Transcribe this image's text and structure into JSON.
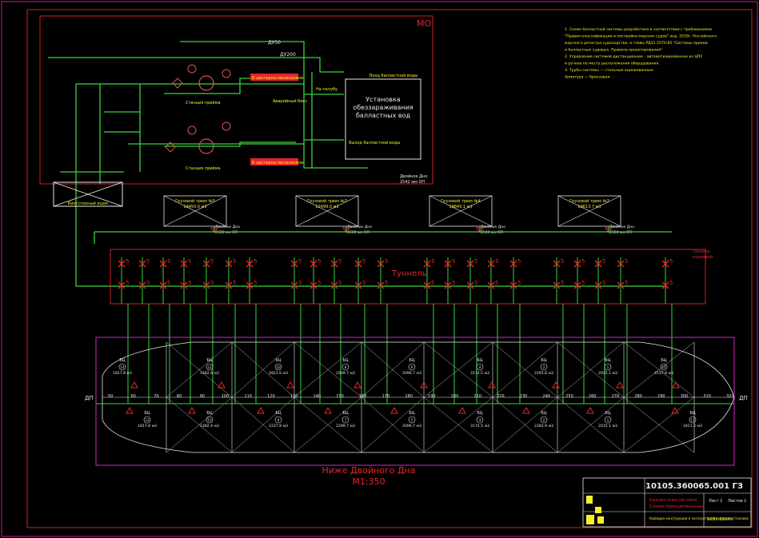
{
  "colors": {
    "background": "#000000",
    "frame": "#cc1b8f",
    "border": "#d42020",
    "pipe": "#39d43a",
    "valve": "#e8242c",
    "text_white": "#e8e8e8",
    "text_yellow": "#f4f02a",
    "hull": "#d028c8",
    "pump": "#e05050"
  },
  "engine_room": {
    "label": "МО",
    "pipe_du50": "ДУ50",
    "pipe_du200": "ДУ200",
    "treatment_unit": "Установка обеззараживания балластных вод",
    "water_inlet": "Вход балластной воды",
    "water_outlet": "Выход балластной воды",
    "to_tanks_a": "В цистерны механизмов",
    "to_tanks_b": "В цистерны механизмов",
    "to_deck": "На палубу",
    "air_box": "Аварийный бокс",
    "from_sea_a": "Станция приёма",
    "from_sea_b": "Станция приёма",
    "db_note": "Двойное Дно\n2542 мм ОП",
    "sea_chest": "Кингстонный ящик"
  },
  "notes": [
    "1. Схема балластной системы разработана в соответствии с требованиями",
    "\"Правил классификации и постройки морских судов\" изд. 2019г. Российского",
    "морского регистра судоходства, и главы РД31.5570-85 \"Системы приема",
    "и балластных судовых. Правила проектирования\"",
    "2. Управление системой дистанционное - автоматизированное из ЦПУ",
    "и ручное по месту расположения оборудования.",
    "3. Трубы системы — стальные оцинкованные.",
    "Арматура — бронзовая."
  ],
  "cargo_holds": [
    {
      "name": "Грузовой трюм №5",
      "volume": "19450.0 м3",
      "db": "Двойное Дно\n2500 мм ОП"
    },
    {
      "name": "Грузовой трюм №3",
      "volume": "22499.0 м3",
      "db": "Двойное Дно\n2500 мм ОП"
    },
    {
      "name": "Грузовой трюм №4",
      "volume": "19849.1 м3",
      "db": "Двойное Дно\n2500 мм ОП"
    },
    {
      "name": "Грузовой трюм №2",
      "volume": "19613.7 м3",
      "db": "Двойное Дно\n2500 мм ОП"
    }
  ],
  "tunnel_label": "Туннель",
  "tunnel_side": "Туннель\nкормовой",
  "frame_ticks": [
    "50",
    "60",
    "70",
    "80",
    "90",
    "100",
    "110",
    "120",
    "130",
    "140",
    "150",
    "160",
    "170",
    "180",
    "190",
    "200",
    "210",
    "220",
    "230",
    "240",
    "250",
    "260",
    "270",
    "280",
    "290",
    "300",
    "310",
    "320"
  ],
  "dp": "ДП",
  "upper_tanks": [
    {
      "id": "БЦ",
      "num": "14",
      "vol": "1817.8 м3"
    },
    {
      "id": "БЦ",
      "num": "12",
      "vol": "1482.4 м3"
    },
    {
      "id": "БЦ",
      "num": "10",
      "vol": "2821.6 м3"
    },
    {
      "id": "БЦ",
      "num": "8",
      "vol": "2509.7 м3"
    },
    {
      "id": "БЦ",
      "num": "6",
      "vol": "2096.7 м3"
    },
    {
      "id": "БЦ",
      "num": "4",
      "vol": "3174.5 м3"
    },
    {
      "id": "БЦ",
      "num": "2",
      "vol": "2265.8 м3"
    },
    {
      "id": "БЦ",
      "num": "1",
      "vol": "2015.1 м3"
    },
    {
      "id": "БЦ",
      "num": "15",
      "vol": "4537.8 м3"
    }
  ],
  "lower_tanks": [
    {
      "id": "БЦ",
      "num": "13",
      "vol": "1817.8 м3"
    },
    {
      "id": "БЦ",
      "num": "11",
      "vol": "1482.4 м3"
    },
    {
      "id": "БЦ",
      "num": "9",
      "vol": "2227.8 м3"
    },
    {
      "id": "БЦ",
      "num": "7",
      "vol": "2299.7 м3"
    },
    {
      "id": "БЦ",
      "num": "5",
      "vol": "2096.7 м3"
    },
    {
      "id": "БЦ",
      "num": "3",
      "vol": "3174.5 м3"
    },
    {
      "id": "БЦ",
      "num": "2",
      "vol": "2282.9 м3"
    },
    {
      "id": "БЦ",
      "num": "1",
      "vol": "2015.1 м3"
    },
    {
      "id": "БЦ",
      "num": "17",
      "vol": "3411.2 м3"
    }
  ],
  "plan_title": "Ниже Двойного Дна",
  "plan_scale": "М1:350",
  "stamp": {
    "code": "10105.360065.001 ГЗ",
    "title_line1": "Балластная система",
    "title_line2": "Схема принципиальная",
    "org": "Кафедра конструкции и эксплуатации судовых установок",
    "sheet": "Лист 1",
    "sheets": "Листов 1",
    "group": "ЭСЭУ-31ХХХ"
  }
}
